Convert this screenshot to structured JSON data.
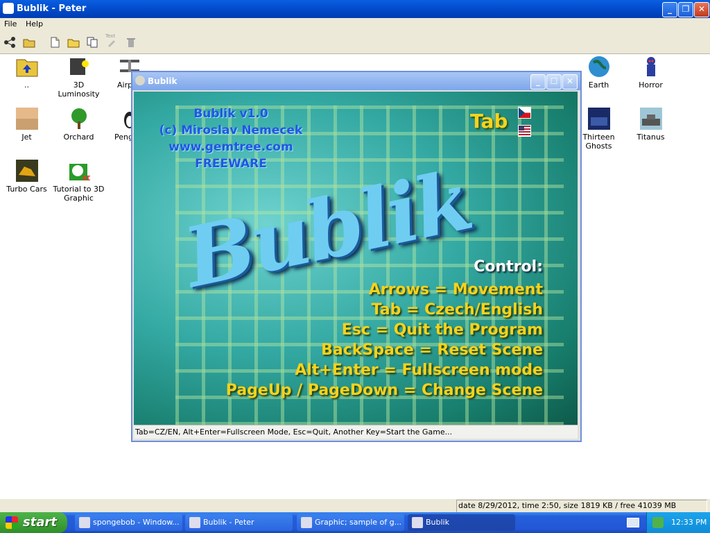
{
  "window": {
    "title": "Bublik - Peter"
  },
  "menu": {
    "file": "File",
    "help": "Help"
  },
  "toolbar": {
    "text_label": "Text"
  },
  "items": [
    {
      "label": ".."
    },
    {
      "label": "3D Luminosity"
    },
    {
      "label": "Airp"
    },
    {
      "label": "Earth"
    },
    {
      "label": "Horror"
    },
    {
      "label": "Jet"
    },
    {
      "label": "Orchard"
    },
    {
      "label": "Peng"
    },
    {
      "label": "Thirteen Ghosts"
    },
    {
      "label": "Titanus"
    },
    {
      "label": "Turbo Cars"
    },
    {
      "label": "Tutorial to 3D Graphic"
    }
  ],
  "status": {
    "text": "date 8/29/2012, time 2:50, size 1819 KB / free 41039 MB"
  },
  "bublik": {
    "title": "Bublik",
    "credits": [
      "Bublik v1.0",
      "(c) Miroslav Nemecek",
      "www.gemtree.com",
      "FREEWARE"
    ],
    "tab": "Tab",
    "logo": "Bublik",
    "control_head": "Control:",
    "controls": [
      "Arrows = Movement",
      "Tab = Czech/English",
      "Esc = Quit the Program",
      "BackSpace = Reset Scene",
      "Alt+Enter = Fullscreen mode",
      "PageUp / PageDown = Change Scene"
    ],
    "status": "Tab=CZ/EN, Alt+Enter=Fullscreen Mode, Esc=Quit, Another Key=Start the Game..."
  },
  "taskbar": {
    "start": "start",
    "tasks": [
      "spongebob - Window...",
      "Bublik - Peter",
      "Graphic;   sample of g...",
      "Bublik"
    ],
    "clock": "12:33 PM"
  }
}
